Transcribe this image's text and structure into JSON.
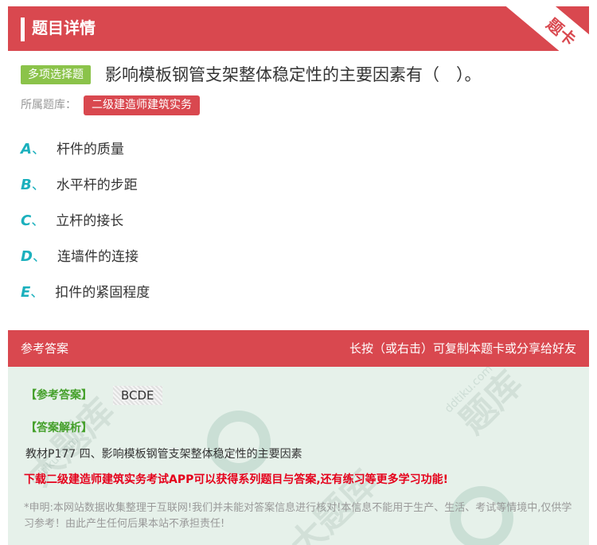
{
  "header": {
    "title": "题目详情",
    "ribbon": "题卡"
  },
  "question": {
    "type_badge": "多项选择题",
    "text": "影响模板钢管支架整体稳定性的主要因素有（　）。",
    "bank_label": "所属题库：",
    "bank_name": "二级建造师建筑实务"
  },
  "options": [
    {
      "letter": "A",
      "sep": "、",
      "text": "杆件的质量"
    },
    {
      "letter": "B",
      "sep": "、",
      "text": "水平杆的步距"
    },
    {
      "letter": "C",
      "sep": "、",
      "text": "立杆的接长"
    },
    {
      "letter": "D",
      "sep": "、",
      "text": "连墙件的连接"
    },
    {
      "letter": "E",
      "sep": "、",
      "text": "扣件的紧固程度"
    }
  ],
  "answer_section": {
    "label": "参考答案",
    "hint": "长按（或右击）可复制本题卡或分享给好友",
    "ref_label": "【参考答案】",
    "ref_value": "BCDE",
    "exp_label": "【答案解析】",
    "explanation": "教材P177 四、影响模板钢管支架整体稳定性的主要因素",
    "promo": "下载二级建造师建筑实务考试APP可以获得系列题目与答案,还有练习等更多学习功能!",
    "disclaimer": "*申明:本网站数据收集整理于互联网!我们并未能对答案信息进行核对!本信息不能用于生产、生活、考试等情境中,仅供学习参考！由此产生任何后果本站不承担责任!"
  },
  "colors": {
    "accent_red": "#d9484f",
    "badge_green": "#8bc34a",
    "option_letter": "#1bb0bd",
    "answer_bg": "#e6f1ea",
    "promo_red": "#e5001b"
  }
}
